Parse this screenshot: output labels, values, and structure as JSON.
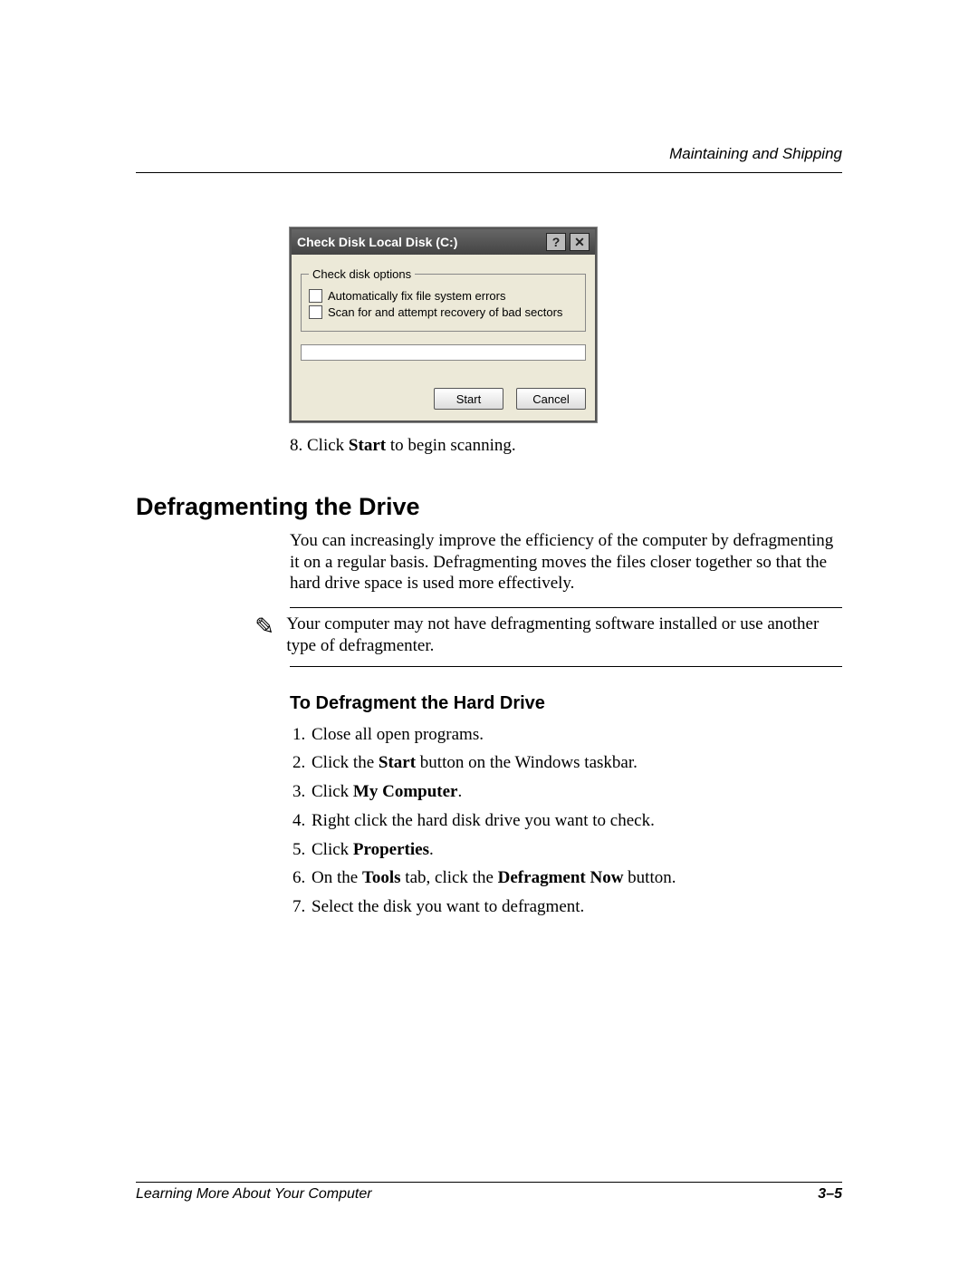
{
  "header": {
    "right": "Maintaining and Shipping"
  },
  "dialog": {
    "title": "Check Disk Local Disk (C:)",
    "help_glyph": "?",
    "close_glyph": "✕",
    "group_legend": "Check disk options",
    "option1": "Automatically fix file system errors",
    "option2": "Scan for and attempt recovery of bad sectors",
    "start_btn": "Start",
    "cancel_btn": "Cancel"
  },
  "step8": {
    "num": "8.",
    "pre": "Click ",
    "bold": "Start",
    "post": " to begin scanning."
  },
  "section_heading": "Defragmenting the Drive",
  "intro_para": "You can increasingly improve the efficiency of the computer by defragmenting it on a regular basis. Defragmenting moves the files closer together so that the hard drive space is used more effectively.",
  "note": {
    "icon": "✎",
    "text": "Your computer may not have defragmenting software installed or use another type of defragmenter."
  },
  "subhead": "To Defragment the Hard Drive",
  "steps": {
    "s1": "Close all open programs.",
    "s2_pre": "Click the ",
    "s2_b": "Start",
    "s2_post": " button on the Windows taskbar.",
    "s3_pre": "Click ",
    "s3_b": "My Computer",
    "s3_post": ".",
    "s4": "Right click the hard disk drive you want to check.",
    "s5_pre": "Click ",
    "s5_b": "Properties",
    "s5_post": ".",
    "s6_pre": "On the ",
    "s6_b1": "Tools",
    "s6_mid": " tab, click the ",
    "s6_b2": "Defragment Now",
    "s6_post": " button.",
    "s7": "Select the disk you want to defragment."
  },
  "footer": {
    "left": "Learning More About Your Computer",
    "right": "3–5"
  }
}
